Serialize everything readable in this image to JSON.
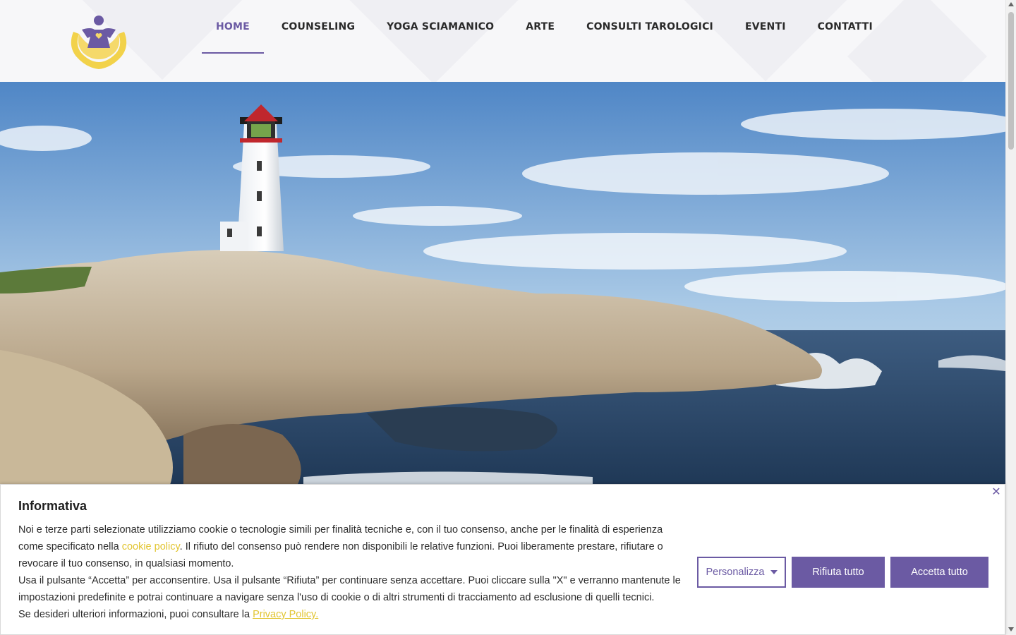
{
  "nav": {
    "items": [
      {
        "label": "HOME",
        "active": true
      },
      {
        "label": "COUNSELING"
      },
      {
        "label": "YOGA SCIAMANICO"
      },
      {
        "label": "ARTE"
      },
      {
        "label": "CONSULTI TAROLOGICI"
      },
      {
        "label": "EVENTI"
      },
      {
        "label": "CONTATTI"
      }
    ]
  },
  "logo": {
    "icon": "angel-hands-icon"
  },
  "hero": {
    "image": "lighthouse-on-rocks-by-the-sea"
  },
  "cookie": {
    "title": "Informativa",
    "p1_a": "Noi e terze parti selezionate utilizziamo cookie o tecnologie simili per finalità tecniche e, con il tuo consenso, anche per le finalità di esperienza come specificato nella ",
    "cookie_policy_link": "cookie policy",
    "p1_b": ". Il rifiuto del consenso può rendere non disponibili le relative funzioni. Puoi liberamente prestare, rifiutare o revocare il tuo consenso, in qualsiasi momento.",
    "p2": "Usa il pulsante “Accetta” per acconsentire. Usa il pulsante “Rifiuta” per continuare senza accettare. Puoi cliccare sulla \"X\" e verranno mantenute le impostazioni predefinite e potrai continuare a navigare senza l'uso di cookie o di altri strumenti di tracciamento ad esclusione di quelli tecnici.",
    "p3": "Se desideri ulteriori informazioni, puoi consultare la ",
    "privacy_link": "Privacy Policy.",
    "customize_label": "Personalizza",
    "reject_label": "Rifiuta tutto",
    "accept_label": "Accetta tutto",
    "close_icon": "close-icon"
  },
  "colors": {
    "accent": "#6b5aa3",
    "link": "#e2c531",
    "logo_yellow": "#f2d24a"
  }
}
